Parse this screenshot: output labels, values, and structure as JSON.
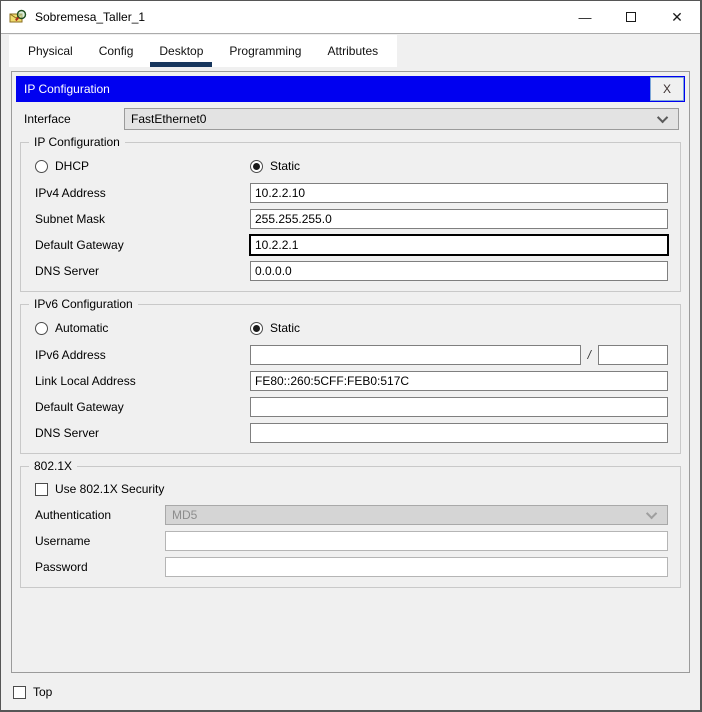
{
  "colors": {
    "header_blue": "#0000f0",
    "tab_underline": "#17365d"
  },
  "window": {
    "title": "Sobremesa_Taller_1",
    "controls": {
      "minimize": "—",
      "close": "✕"
    }
  },
  "tabs": [
    {
      "label": "Physical",
      "active": false
    },
    {
      "label": "Config",
      "active": false
    },
    {
      "label": "Desktop",
      "active": true
    },
    {
      "label": "Programming",
      "active": false
    },
    {
      "label": "Attributes",
      "active": false
    }
  ],
  "panel": {
    "header": {
      "title": "IP Configuration",
      "close_label": "X"
    },
    "interface": {
      "label": "Interface",
      "value": "FastEthernet0"
    },
    "ip_group": {
      "title": "IP Configuration",
      "radios": [
        {
          "label": "DHCP",
          "selected": false
        },
        {
          "label": "Static",
          "selected": true
        }
      ],
      "fields": [
        {
          "label": "IPv4 Address",
          "value": "10.2.2.10"
        },
        {
          "label": "Subnet Mask",
          "value": "255.255.255.0"
        },
        {
          "label": "Default Gateway",
          "value": "10.2.2.1",
          "focused": true
        },
        {
          "label": "DNS Server",
          "value": "0.0.0.0"
        }
      ]
    },
    "ipv6_group": {
      "title": "IPv6 Configuration",
      "radios": [
        {
          "label": "Automatic",
          "selected": false
        },
        {
          "label": "Static",
          "selected": true
        }
      ],
      "ipv6_address": {
        "label": "IPv6 Address",
        "value": "",
        "prefix": "",
        "separator": "/"
      },
      "fields": [
        {
          "label": "Link Local Address",
          "value": "FE80::260:5CFF:FEB0:517C"
        },
        {
          "label": "Default Gateway",
          "value": ""
        },
        {
          "label": "DNS Server",
          "value": ""
        }
      ]
    },
    "dot1x_group": {
      "title": "802.1X",
      "checkbox": {
        "label": "Use 802.1X Security",
        "checked": false
      },
      "authentication": {
        "label": "Authentication",
        "value": "MD5",
        "disabled": true
      },
      "username": {
        "label": "Username",
        "value": ""
      },
      "password": {
        "label": "Password",
        "value": ""
      }
    }
  },
  "footer": {
    "top_checkbox": {
      "label": "Top",
      "checked": false
    }
  }
}
